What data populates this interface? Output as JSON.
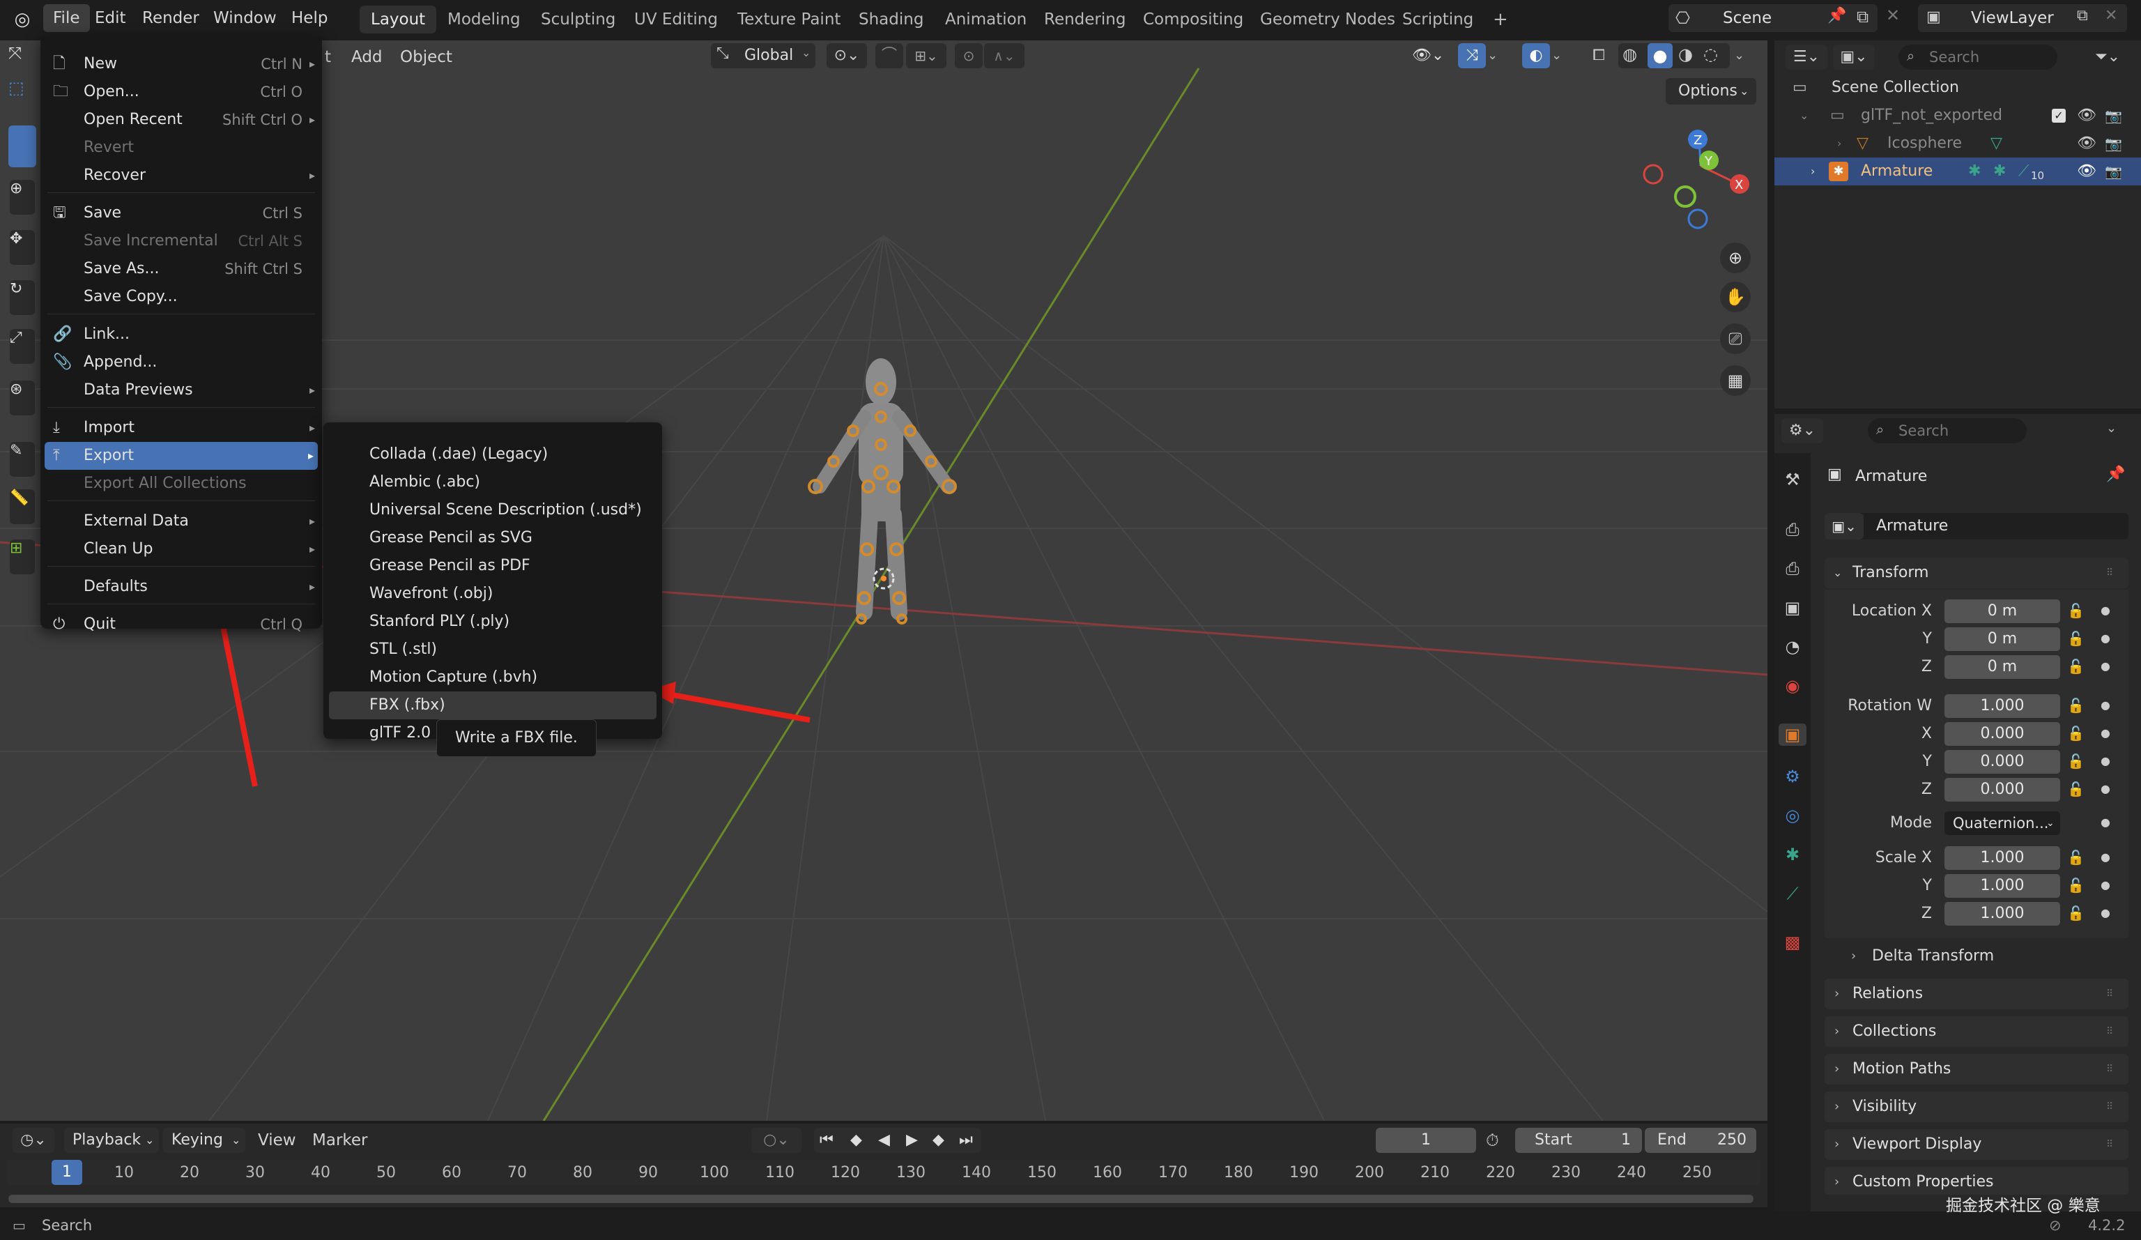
{
  "topbar": {
    "menus": [
      "File",
      "Edit",
      "Render",
      "Window",
      "Help"
    ],
    "workspaces": [
      "Layout",
      "Modeling",
      "Sculpting",
      "UV Editing",
      "Texture Paint",
      "Shading",
      "Animation",
      "Rendering",
      "Compositing",
      "Geometry Nodes",
      "Scripting"
    ],
    "active_workspace": "Layout",
    "add_tab": "+",
    "scene": "Scene",
    "view_layer": "ViewLayer"
  },
  "viewport_header": {
    "add": "Add",
    "object": "Object",
    "partial_t": "t",
    "orientation": "Global",
    "options": "Options"
  },
  "file_menu": {
    "items": [
      {
        "label": "New",
        "shortcut": "Ctrl N",
        "icon": "new-file-icon",
        "submenu": true
      },
      {
        "label": "Open...",
        "shortcut": "Ctrl O",
        "icon": "folder-icon"
      },
      {
        "label": "Open Recent",
        "shortcut": "Shift Ctrl O",
        "submenu": true
      },
      {
        "label": "Revert",
        "disabled": true
      },
      {
        "label": "Recover",
        "submenu": true
      },
      {
        "label": "Save",
        "shortcut": "Ctrl S",
        "icon": "save-icon"
      },
      {
        "label": "Save Incremental",
        "shortcut": "Ctrl Alt S",
        "disabled": true
      },
      {
        "label": "Save As...",
        "shortcut": "Shift Ctrl S"
      },
      {
        "label": "Save Copy..."
      },
      {
        "label": "Link...",
        "icon": "link-icon"
      },
      {
        "label": "Append...",
        "icon": "append-icon"
      },
      {
        "label": "Data Previews",
        "submenu": true
      },
      {
        "label": "Import",
        "icon": "import-icon",
        "submenu": true
      },
      {
        "label": "Export",
        "icon": "export-icon",
        "submenu": true,
        "highlighted": true
      },
      {
        "label": "Export All Collections",
        "disabled": true
      },
      {
        "label": "External Data",
        "submenu": true
      },
      {
        "label": "Clean Up",
        "submenu": true
      },
      {
        "label": "Defaults",
        "submenu": true
      },
      {
        "label": "Quit",
        "shortcut": "Ctrl Q",
        "icon": "power-icon"
      }
    ]
  },
  "export_menu": {
    "items": [
      "Collada (.dae) (Legacy)",
      "Alembic (.abc)",
      "Universal Scene Description (.usd*)",
      "Grease Pencil as SVG",
      "Grease Pencil as PDF",
      "Wavefront (.obj)",
      "Stanford PLY (.ply)",
      "STL (.stl)",
      "Motion Capture (.bvh)",
      "FBX (.fbx)",
      "glTF 2.0 (.glb/.gltf)"
    ],
    "highlighted": "FBX (.fbx)"
  },
  "tooltip": "Write a FBX file.",
  "outliner": {
    "search_placeholder": "Search",
    "scene_collection": "Scene Collection",
    "rows": [
      {
        "label": "glTF_not_exported",
        "dim": true
      },
      {
        "label": "Icosphere",
        "dim": true
      },
      {
        "label": "Armature",
        "selected": true
      }
    ],
    "bone_count": "10"
  },
  "properties": {
    "search_placeholder": "Search",
    "object_name": "Armature",
    "data_name": "Armature",
    "transform_title": "Transform",
    "location_label": "Location X",
    "rotation_label": "Rotation W",
    "mode_label": "Mode",
    "mode_value": "Quaternion...",
    "scale_label": "Scale X",
    "y": "Y",
    "z": "Z",
    "x": "X",
    "loc_values": [
      "0 m",
      "0 m",
      "0 m"
    ],
    "rot_values": [
      "1.000",
      "0.000",
      "0.000",
      "0.000"
    ],
    "scale_values": [
      "1.000",
      "1.000",
      "1.000"
    ],
    "delta": "Delta Transform",
    "panels": [
      "Relations",
      "Collections",
      "Motion Paths",
      "Visibility",
      "Viewport Display",
      "Custom Properties"
    ]
  },
  "timeline": {
    "playback": "Playback",
    "keying": "Keying",
    "view": "View",
    "marker": "Marker",
    "current_frame": "1",
    "start_label": "Start",
    "start": "1",
    "end_label": "End",
    "end": "250",
    "ticks": [
      "1",
      "10",
      "20",
      "30",
      "40",
      "50",
      "60",
      "70",
      "80",
      "90",
      "100",
      "110",
      "120",
      "130",
      "140",
      "150",
      "160",
      "170",
      "180",
      "190",
      "200",
      "210",
      "220",
      "230",
      "240",
      "250"
    ]
  },
  "statusbar": {
    "search": "Search",
    "version": "4.2.2",
    "watermark": "掘金技术社区 @ 樂意"
  }
}
